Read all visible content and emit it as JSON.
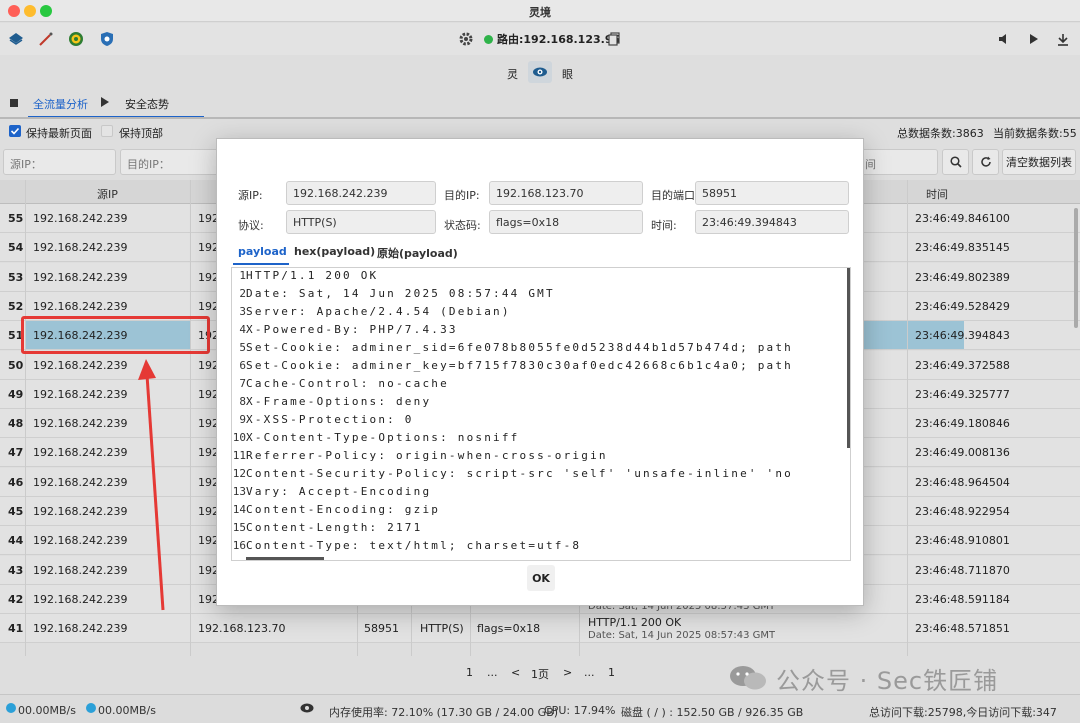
{
  "window": {
    "title": "灵境"
  },
  "toolbar": {
    "route_label": "路由:192.168.123.95",
    "icons": [
      "layers-icon",
      "wand-icon",
      "target-icon",
      "shield-icon",
      "gear-icon",
      "copy-icon",
      "volume-icon",
      "play-icon",
      "download-icon"
    ]
  },
  "logo": {
    "left": "灵",
    "right": "眼"
  },
  "tabs": {
    "items": [
      {
        "label": "全流量分析"
      },
      {
        "label": "安全态势"
      }
    ]
  },
  "options": {
    "keep_latest": "保持最新页面",
    "keep_top": "保持顶部",
    "total_count": "总数据条数:3863",
    "current_count": "当前数据条数:55"
  },
  "filters": {
    "src_ip_placeholder": "源IP：",
    "dst_ip_placeholder": "目的IP：",
    "tail_placeholder": "间",
    "clear_button": "清空数据列表"
  },
  "table": {
    "headers": {
      "src_ip": "源IP",
      "time": "时间"
    },
    "rows": [
      {
        "n": "55",
        "src": "192.168.242.239",
        "dst": "192",
        "time": "23:46:49.846100"
      },
      {
        "n": "54",
        "src": "192.168.242.239",
        "dst": "192",
        "time": "23:46:49.835145"
      },
      {
        "n": "53",
        "src": "192.168.242.239",
        "dst": "192",
        "time": "23:46:49.802389"
      },
      {
        "n": "52",
        "src": "192.168.242.239",
        "dst": "192",
        "time": "23:46:49.528429"
      },
      {
        "n": "51",
        "src": "192.168.242.239",
        "dst": "192",
        "time": "23:46:49.394843"
      },
      {
        "n": "50",
        "src": "192.168.242.239",
        "dst": "192",
        "time": "23:46:49.372588"
      },
      {
        "n": "49",
        "src": "192.168.242.239",
        "dst": "192",
        "time": "23:46:49.325777"
      },
      {
        "n": "48",
        "src": "192.168.242.239",
        "dst": "192",
        "time": "23:46:49.180846"
      },
      {
        "n": "47",
        "src": "192.168.242.239",
        "dst": "192",
        "time": "23:46:49.008136"
      },
      {
        "n": "46",
        "src": "192.168.242.239",
        "dst": "192",
        "time": "23:46:48.964504"
      },
      {
        "n": "45",
        "src": "192.168.242.239",
        "dst": "192",
        "time": "23:46:48.922954"
      },
      {
        "n": "44",
        "src": "192.168.242.239",
        "dst": "192",
        "time": "23:46:48.910801"
      },
      {
        "n": "43",
        "src": "192.168.242.239",
        "dst": "192",
        "time": "23:46:48.711870"
      },
      {
        "n": "42",
        "src": "192.168.242.239",
        "dst": "192",
        "time": "23:46:48.591184"
      },
      {
        "n": "41",
        "src": "192.168.242.239",
        "dst": "192.168.123.70",
        "port": "58951",
        "proto": "HTTP(S)",
        "flags": "flags=0x18",
        "info1": "HTTP/1.1 200 OK",
        "info2": "Date: Sat, 14 Jun 2025 08:57:43 GMT",
        "time": "23:46:48.571851"
      }
    ],
    "row42_info": "Date: Sat, 14 Jun 2025 08:57:43 GMT"
  },
  "modal": {
    "src_ip_label": "源IP:",
    "src_ip": "192.168.242.239",
    "dst_ip_label": "目的IP:",
    "dst_ip": "192.168.123.70",
    "dst_port_label": "目的端口:",
    "dst_port": "58951",
    "proto_label": "协议:",
    "proto": "HTTP(S)",
    "status_label": "状态码:",
    "status": "flags=0x18",
    "time_label": "时间:",
    "time": "23:46:49.394843",
    "tabs": [
      "payload",
      "hex(payload)",
      "原始(payload)"
    ],
    "lines": [
      "HTTP/1.1 200 OK",
      "Date: Sat, 14 Jun 2025 08:57:44 GMT",
      "Server: Apache/2.4.54 (Debian)",
      "X-Powered-By: PHP/7.4.33",
      "Set-Cookie: adminer_sid=6fe078b8055fe0d5238d44b1d57b474d; path",
      "Set-Cookie: adminer_key=bf715f7830c30af0edc42668c6b1c4a0; path",
      "Cache-Control: no-cache",
      "X-Frame-Options: deny",
      "X-XSS-Protection: 0",
      "X-Content-Type-Options: nosniff",
      "Referrer-Policy: origin-when-cross-origin",
      "Content-Security-Policy: script-src 'self' 'unsafe-inline' 'no",
      "Vary: Accept-Encoding",
      "Content-Encoding: gzip",
      "Content-Length: 2171",
      "Content-Type: text/html; charset=utf-8"
    ],
    "ok_label": "OK"
  },
  "pager": {
    "first": "1",
    "ellipsis1": "...",
    "prev": "<",
    "page": "1页",
    "next": ">",
    "ellipsis2": "...",
    "last": "1"
  },
  "status": {
    "upload": "00.00MB/s",
    "download": "00.00MB/s",
    "memory": "内存使用率: 72.10% (17.30 GB / 24.00 GB)",
    "cpu": "CPU: 17.94%",
    "disk": "磁盘 ( / ) : 152.50 GB / 926.35 GB",
    "visits": "总访问下载:25798,今日访问下载:347"
  },
  "watermark": "公众号 · Sec铁匠铺",
  "colors": {
    "accent": "#1d63c9",
    "highlight_row": "#9cc3d5",
    "annotation": "#e53935",
    "status_green": "#2fb34a"
  }
}
